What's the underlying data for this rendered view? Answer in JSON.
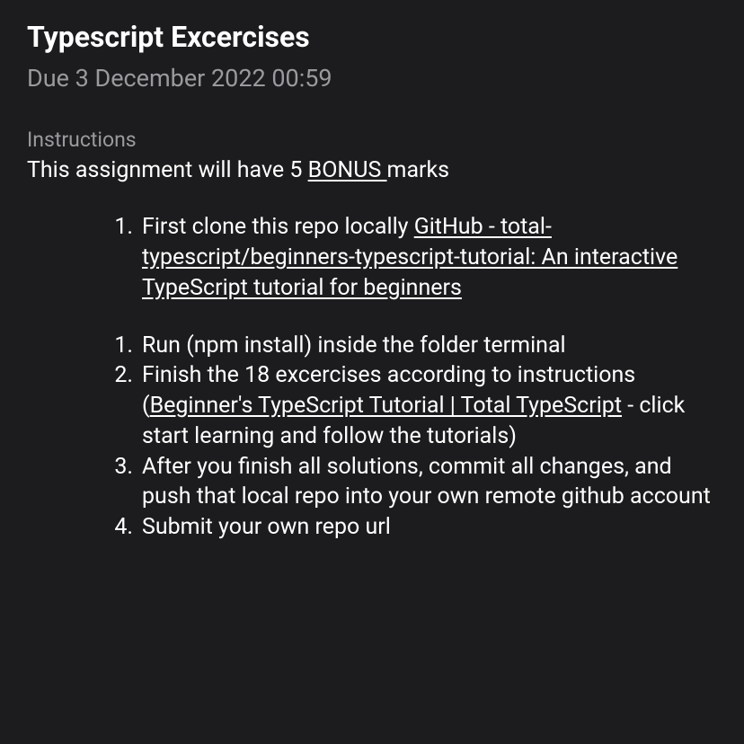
{
  "title": "Typescript Excercises",
  "due_date": "Due 3 December 2022 00:59",
  "instructions_label": "Instructions",
  "instructions_text_part1": "This assignment will have 5 ",
  "instructions_text_bonus": "BONUS ",
  "instructions_text_part2": "marks",
  "list1": {
    "item1": {
      "num": "1.",
      "text_before": "First clone this repo locally ",
      "link_text": "GitHub - total-typescript/beginners-typescript-tutorial: An interactive TypeScript tutorial for beginners"
    }
  },
  "list2": {
    "item1": {
      "num": "1.",
      "text": "Run (npm install) inside the folder terminal"
    },
    "item2": {
      "num": "2.",
      "text_before": "Finish the 18 excercises according to instructions (",
      "link_text": "Beginner's TypeScript Tutorial | Total TypeScript",
      "text_after": " - click start learning and follow the tutorials)"
    },
    "item3": {
      "num": "3.",
      "text": "After you finish all solutions, commit all changes, and push that local repo into your own remote github account"
    },
    "item4": {
      "num": "4.",
      "text": "Submit your own repo url"
    }
  }
}
